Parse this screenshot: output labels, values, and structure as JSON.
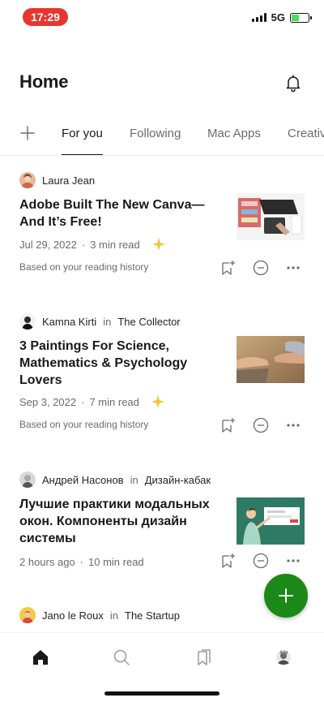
{
  "status_bar": {
    "time": "17:29",
    "network": "5G"
  },
  "header": {
    "title": "Home"
  },
  "tabs": [
    {
      "label": "For you",
      "active": true
    },
    {
      "label": "Following",
      "active": false
    },
    {
      "label": "Mac Apps",
      "active": false
    },
    {
      "label": "Creativ",
      "active": false
    }
  ],
  "articles": [
    {
      "author": "Laura Jean",
      "in_word": "",
      "publication": "",
      "title": "Adobe Built The New Canva—And It’s Free!",
      "date": "Jul 29, 2022",
      "read_time": "3 min read",
      "reason": "Based on your reading history",
      "member_only": true
    },
    {
      "author": "Kamna Kirti",
      "in_word": "in",
      "publication": "The Collector",
      "title": "3 Paintings For Science, Mathematics & Psychology Lovers",
      "date": "Sep 3, 2022",
      "read_time": "7 min read",
      "reason": "Based on your reading history",
      "member_only": true
    },
    {
      "author": "Андрей Насонов",
      "in_word": "in",
      "publication": "Дизайн-кабак",
      "title": "Лучшие практики модальных окон. Компоненты дизайн системы",
      "date": "2 hours ago",
      "read_time": "10 min read",
      "reason": "",
      "member_only": false
    },
    {
      "author": "Jano le Roux",
      "in_word": "in",
      "publication": "The Startup"
    }
  ],
  "meta_separator": "·",
  "colors": {
    "accent_green": "#1a8917",
    "member_star": "#f4c430",
    "time_pill": "#e8352f"
  },
  "icons": [
    "bell-icon",
    "plus-icon",
    "bookmark-add-icon",
    "show-less-icon",
    "more-icon",
    "sparkle-icon",
    "home-icon",
    "search-icon",
    "library-icon",
    "profile-icon",
    "compose-icon"
  ]
}
